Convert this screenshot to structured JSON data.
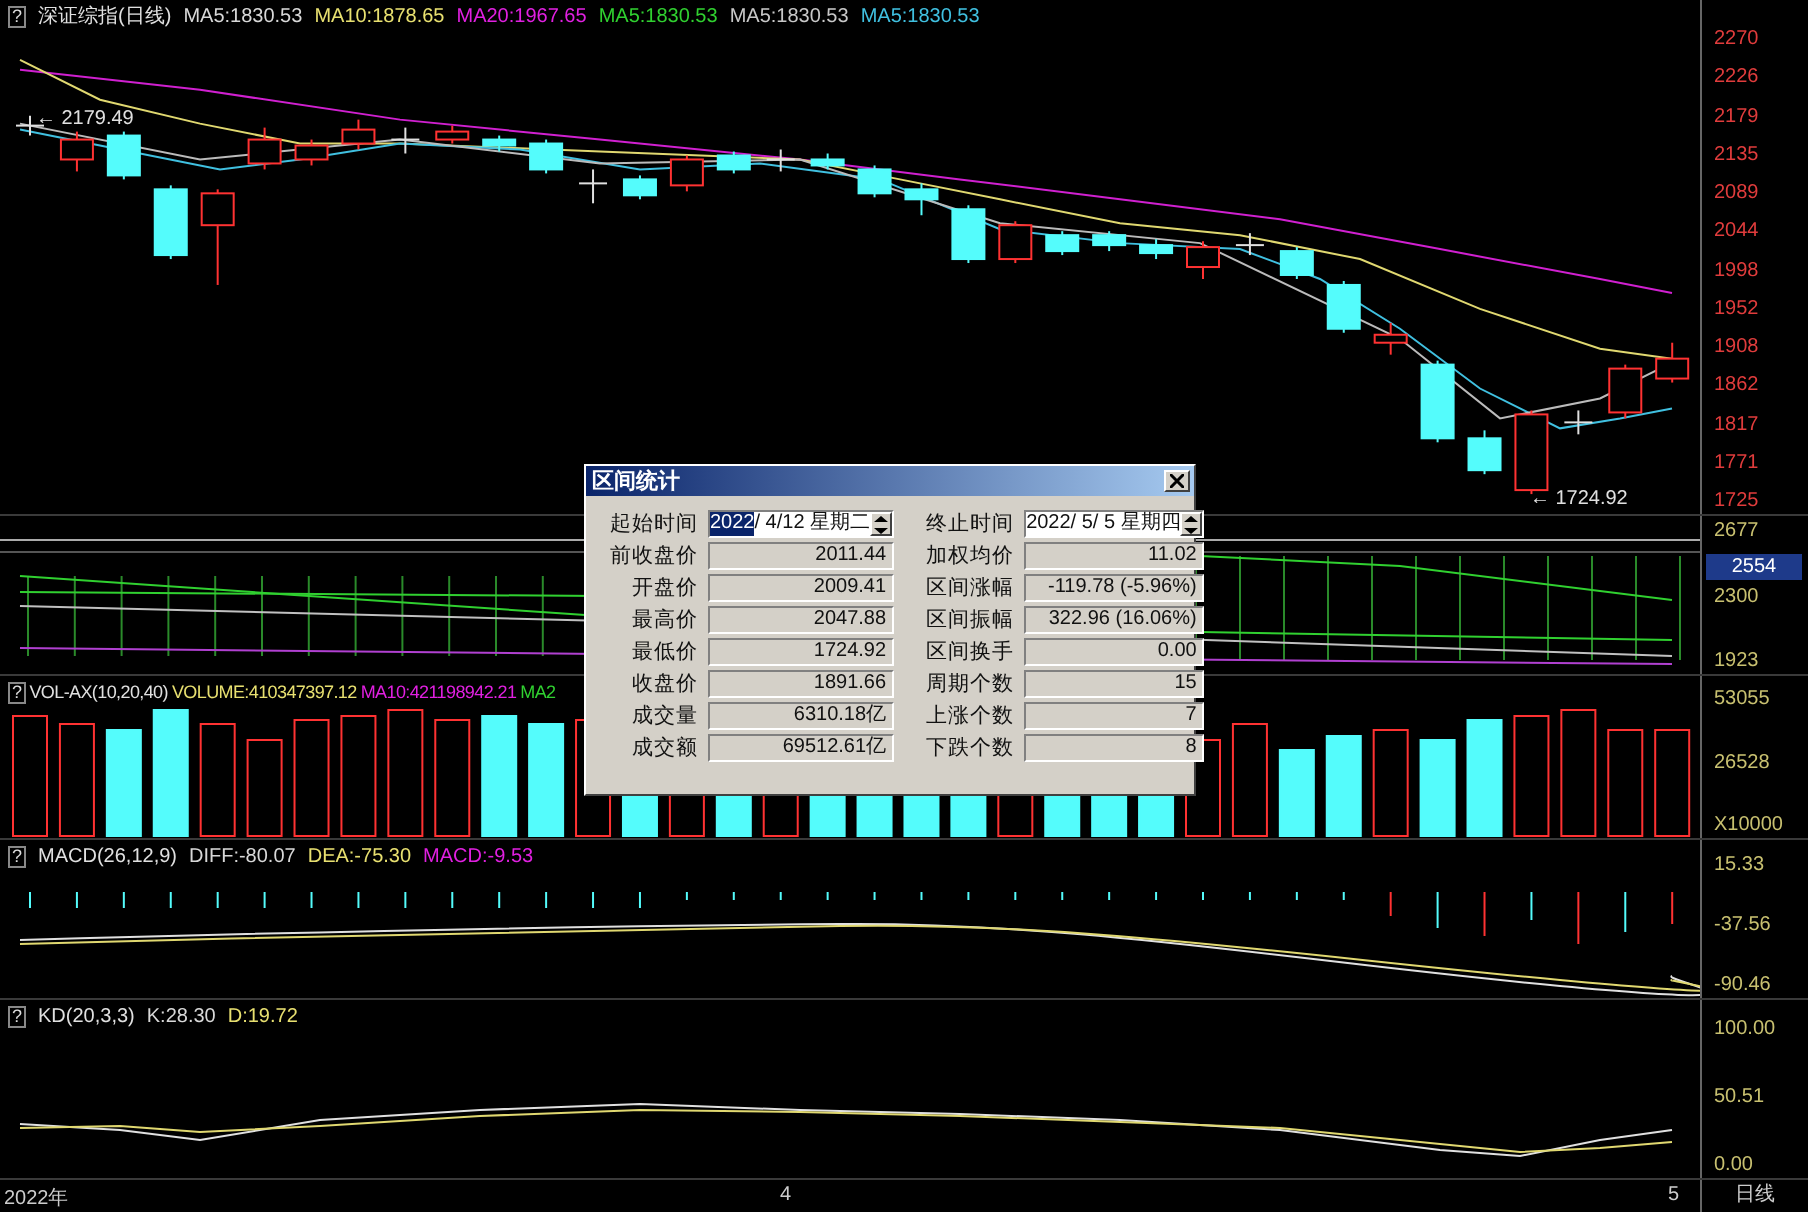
{
  "price_panel": {
    "help_mark": "?",
    "title": "深证综指(日线)",
    "indicators": [
      {
        "text": "MA5:1830.53",
        "color": "#d8d8d8"
      },
      {
        "text": "MA10:1878.65",
        "color": "#e8e070"
      },
      {
        "text": "MA20:1967.65",
        "color": "#e020e0"
      },
      {
        "text": "MA5:1830.53",
        "color": "#30d030"
      },
      {
        "text": "MA5:1830.53",
        "color": "#c8c8c8"
      },
      {
        "text": "MA5:1830.53",
        "color": "#40c0e0"
      }
    ],
    "annotations": [
      "← 2179.49",
      "← 1724.92"
    ],
    "axis_labels": [
      "2270",
      "2226",
      "2179",
      "2135",
      "2089",
      "2044",
      "1998",
      "1952",
      "1908",
      "1862",
      "1817",
      "1771",
      "1725"
    ]
  },
  "indicator_panel": {
    "axis_labels": [
      "2677",
      "2300",
      "1923"
    ],
    "current_value": "2554"
  },
  "volume_panel": {
    "help_mark": "?",
    "title": "VOL-AX(10,20,40)",
    "indicators": [
      {
        "text": "VOLUME:410347397.12",
        "color": "#e8e070"
      },
      {
        "text": "MA10:421198942.21",
        "color": "#e020e0"
      },
      {
        "text": "MA2",
        "color": "#30d030"
      }
    ],
    "axis_labels": [
      "53055",
      "26528",
      "X10000"
    ]
  },
  "macd_panel": {
    "help_mark": "?",
    "title": "MACD(26,12,9)",
    "indicators": [
      {
        "text": "DIFF:-80.07",
        "color": "#d8d8d8"
      },
      {
        "text": "DEA:-75.30",
        "color": "#e8e070"
      },
      {
        "text": "MACD:-9.53",
        "color": "#e020e0"
      }
    ],
    "axis_labels": [
      "15.33",
      "-37.56",
      "-90.46"
    ]
  },
  "kd_panel": {
    "help_mark": "?",
    "title": "KD(20,3,3)",
    "indicators": [
      {
        "text": "K:28.30",
        "color": "#d8d8d8"
      },
      {
        "text": "D:19.72",
        "color": "#e8e070"
      }
    ],
    "axis_labels": [
      "100.00",
      "50.51",
      "0.00"
    ]
  },
  "time_axis": {
    "labels": [
      "2022年",
      "4",
      "5"
    ],
    "period": "日线"
  },
  "dialog": {
    "title": "区间统计",
    "start": {
      "label": "起始时间",
      "parts": [
        {
          "text": "2022",
          "selected": true
        },
        {
          "text": "/ 4/12 星期二",
          "selected": false
        }
      ]
    },
    "end": {
      "label": "终止时间",
      "parts": [
        {
          "text": "2022/ 5/ 5 星期四",
          "selected": false
        }
      ]
    },
    "left_rows": [
      {
        "label": "前收盘价",
        "value": "2011.44"
      },
      {
        "label": "开盘价",
        "value": "2009.41"
      },
      {
        "label": "最高价",
        "value": "2047.88"
      },
      {
        "label": "最低价",
        "value": "1724.92"
      },
      {
        "label": "收盘价",
        "value": "1891.66"
      },
      {
        "label": "成交量",
        "value": "6310.18亿"
      },
      {
        "label": "成交额",
        "value": "69512.61亿"
      }
    ],
    "right_rows": [
      {
        "label": "加权均价",
        "value": "11.02"
      },
      {
        "label": "区间涨幅",
        "value": "-119.78 (-5.96%)"
      },
      {
        "label": "区间振幅",
        "value": "322.96 (16.06%)"
      },
      {
        "label": "区间换手",
        "value": "0.00"
      },
      {
        "label": "周期个数",
        "value": "15"
      },
      {
        "label": "上涨个数",
        "value": "7"
      },
      {
        "label": "下跌个数",
        "value": "8"
      }
    ]
  }
}
